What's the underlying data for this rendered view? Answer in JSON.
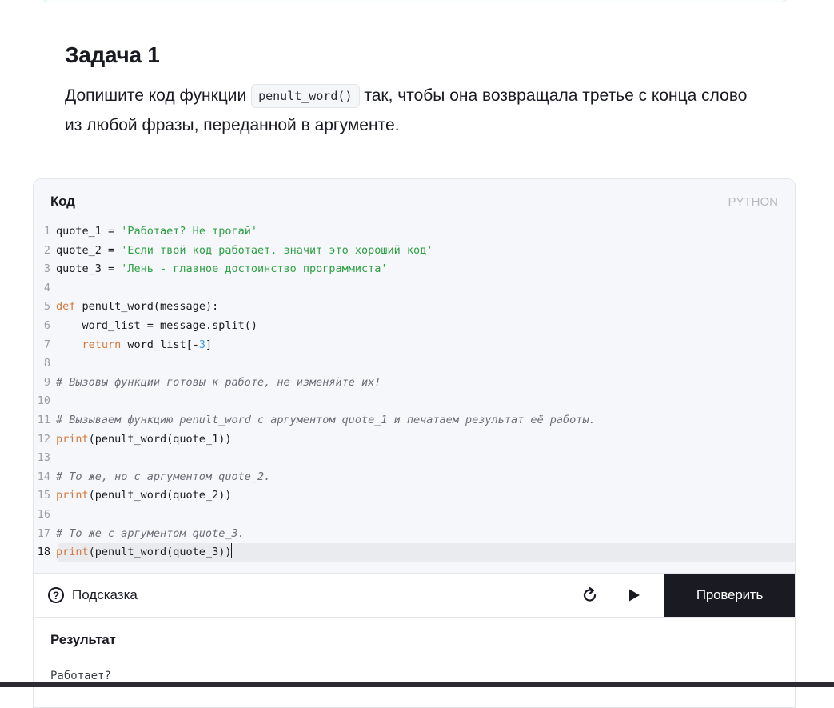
{
  "task": {
    "title": "Задача 1",
    "text_before": "Допишите код функции ",
    "inline_code": "penult_word()",
    "text_after": " так, чтобы она возвращала третье с конца слово из любой фразы, переданной в аргументе."
  },
  "editor": {
    "label": "Код",
    "language": "PYTHON",
    "lines": {
      "l1": {
        "n": "1",
        "a": "quote_1 = ",
        "s": "'Работает? Не трогай'"
      },
      "l2": {
        "n": "2",
        "a": "quote_2 = ",
        "s": "'Если твой код работает, значит это хороший код'"
      },
      "l3": {
        "n": "3",
        "a": "quote_3 = ",
        "s": "'Лень - главное достоинство программиста'"
      },
      "l4": {
        "n": "4"
      },
      "l5": {
        "n": "5",
        "k": "def",
        "a": " penult_word(message):"
      },
      "l6": {
        "n": "6",
        "a": "    word_list = message.split()"
      },
      "l7": {
        "n": "7",
        "i": "    ",
        "k": "return",
        "a": " word_list[-",
        "num": "3",
        "b": "]"
      },
      "l8": {
        "n": "8"
      },
      "l9": {
        "n": "9",
        "c": "# Вызовы функции готовы к работе, не изменяйте их!"
      },
      "l10": {
        "n": "10"
      },
      "l11": {
        "n": "11",
        "c": "# Вызываем функцию penult_word с аргументом quote_1 и печатаем результат её работы."
      },
      "l12": {
        "n": "12",
        "k": "print",
        "a": "(penult_word(quote_1))"
      },
      "l13": {
        "n": "13"
      },
      "l14": {
        "n": "14",
        "c": "# То же, но с аргументом quote_2."
      },
      "l15": {
        "n": "15",
        "k": "print",
        "a": "(penult_word(quote_2))"
      },
      "l16": {
        "n": "16"
      },
      "l17": {
        "n": "17",
        "c": "# То же с аргументом quote_3."
      },
      "l18": {
        "n": "18",
        "k": "print",
        "a": "(penult_word(quote_3))"
      }
    }
  },
  "toolbar": {
    "hint_label": "Подсказка",
    "hint_icon_glyph": "?",
    "check_label": "Проверить"
  },
  "result": {
    "label": "Результат",
    "output": "Работает?"
  }
}
